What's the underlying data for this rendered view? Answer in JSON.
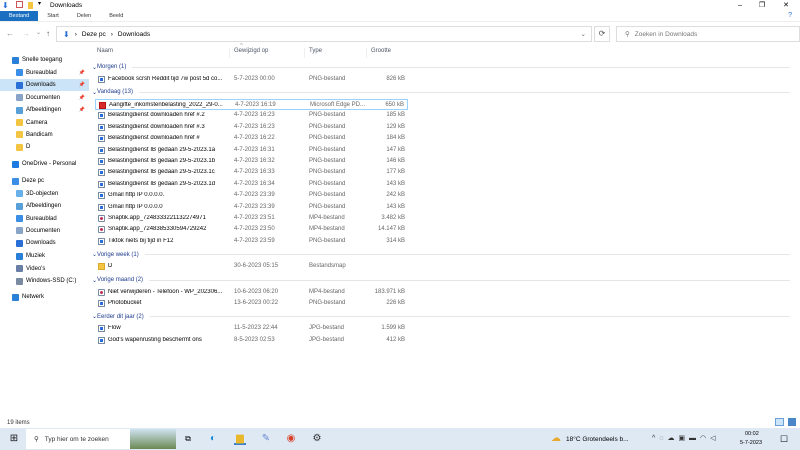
{
  "window": {
    "title": "Downloads"
  },
  "ribbon": {
    "tabs": [
      "Bestand",
      "Start",
      "Delen",
      "Beeld"
    ]
  },
  "address": {
    "crumbs": [
      "Deze pc",
      "Downloads"
    ],
    "search_placeholder": "Zoeken in Downloads"
  },
  "columns": {
    "name": "Naam",
    "date": "Gewijzigd op",
    "type": "Type",
    "size": "Grootte"
  },
  "sidebar": [
    {
      "label": "Snelle toegang",
      "icon": "star-icon",
      "color": "#2a7fd6",
      "indent": 0
    },
    {
      "label": "Bureaublad",
      "icon": "desktop-icon",
      "color": "#3a8ee6",
      "indent": 1,
      "pin": true
    },
    {
      "label": "Downloads",
      "icon": "download-icon",
      "color": "#2a6fd6",
      "indent": 1,
      "pin": true,
      "selected": true
    },
    {
      "label": "Documenten",
      "icon": "documents-icon",
      "color": "#8aa4c8",
      "indent": 1,
      "pin": true
    },
    {
      "label": "Afbeeldingen",
      "icon": "pictures-icon",
      "color": "#5aa0d8",
      "indent": 1,
      "pin": true
    },
    {
      "label": "Camera",
      "icon": "folder-icon",
      "color": "#f4c542",
      "indent": 1
    },
    {
      "label": "Bandicam",
      "icon": "folder-icon",
      "color": "#f4c542",
      "indent": 1
    },
    {
      "label": "D",
      "icon": "folder-icon",
      "color": "#f4c542",
      "indent": 1
    },
    {
      "label": "OneDrive - Personal",
      "icon": "cloud-icon",
      "color": "#1d7ae0",
      "indent": 0
    },
    {
      "label": "Deze pc",
      "icon": "computer-icon",
      "color": "#3a8ee6",
      "indent": 0
    },
    {
      "label": "3D-objecten",
      "icon": "cube-icon",
      "color": "#6ab0e8",
      "indent": 1
    },
    {
      "label": "Afbeeldingen",
      "icon": "pictures-icon",
      "color": "#5aa0d8",
      "indent": 1
    },
    {
      "label": "Bureaublad",
      "icon": "desktop-icon",
      "color": "#3a8ee6",
      "indent": 1
    },
    {
      "label": "Documenten",
      "icon": "documents-icon",
      "color": "#8aa4c8",
      "indent": 1
    },
    {
      "label": "Downloads",
      "icon": "download-icon",
      "color": "#2a6fd6",
      "indent": 1
    },
    {
      "label": "Muziek",
      "icon": "music-icon",
      "color": "#2a7fd6",
      "indent": 1
    },
    {
      "label": "Video's",
      "icon": "video-icon",
      "color": "#6a7fa6",
      "indent": 1
    },
    {
      "label": "Windows-SSD (C:)",
      "icon": "drive-icon",
      "color": "#7a8aa0",
      "indent": 1
    },
    {
      "label": "Netwerk",
      "icon": "network-icon",
      "color": "#2a7fd6",
      "indent": 0
    }
  ],
  "groups": [
    {
      "label": "Morgen (1)",
      "files": [
        {
          "name": "Facebook scrsh Reddit tijd 7w post 5d co...",
          "date": "5-7-2023 00:00",
          "type": "PNG-bestand",
          "size": "826 kB",
          "kind": "png"
        }
      ]
    },
    {
      "label": "Vandaag (13)",
      "files": [
        {
          "name": "Aangifte_inkomstenbelasting_2022_29-0...",
          "date": "4-7-2023 16:19",
          "type": "Microsoft Edge PD...",
          "size": "650 kB",
          "kind": "pdf",
          "selected": true
        },
        {
          "name": "Belastingdienst downloaden href #.2",
          "date": "4-7-2023 16:23",
          "type": "PNG-bestand",
          "size": "185 kB",
          "kind": "png"
        },
        {
          "name": "Belastingdienst downloaden href #.3",
          "date": "4-7-2023 16:23",
          "type": "PNG-bestand",
          "size": "129 kB",
          "kind": "png"
        },
        {
          "name": "Belastingdienst downloaden href #",
          "date": "4-7-2023 16:22",
          "type": "PNG-bestand",
          "size": "184 kB",
          "kind": "png"
        },
        {
          "name": "Belastingdienst IB gedaan 29-5-2023.1a",
          "date": "4-7-2023 16:31",
          "type": "PNG-bestand",
          "size": "147 kB",
          "kind": "png"
        },
        {
          "name": "Belastingdienst IB gedaan 29-5-2023.1b",
          "date": "4-7-2023 16:32",
          "type": "PNG-bestand",
          "size": "146 kB",
          "kind": "png"
        },
        {
          "name": "Belastingdienst IB gedaan 29-5-2023.1c",
          "date": "4-7-2023 16:33",
          "type": "PNG-bestand",
          "size": "177 kB",
          "kind": "png"
        },
        {
          "name": "Belastingdienst IB gedaan 29-5-2023.1d",
          "date": "4-7-2023 16:34",
          "type": "PNG-bestand",
          "size": "143 kB",
          "kind": "png"
        },
        {
          "name": "Gmail http IP 0.0.0.0.",
          "date": "4-7-2023 23:39",
          "type": "PNG-bestand",
          "size": "242 kB",
          "kind": "png"
        },
        {
          "name": "Gmail http IP 0.0.0.0",
          "date": "4-7-2023 23:39",
          "type": "PNG-bestand",
          "size": "143 kB",
          "kind": "png"
        },
        {
          "name": "Snaptik.app_7248333221132274971",
          "date": "4-7-2023 23:51",
          "type": "MP4-bestand",
          "size": "3.482 kB",
          "kind": "mp4"
        },
        {
          "name": "Snaptik.app_7248385330594729242",
          "date": "4-7-2023 23:50",
          "type": "MP4-bestand",
          "size": "14.147 kB",
          "kind": "mp4"
        },
        {
          "name": "Tiktok niets bij tijd in F12",
          "date": "4-7-2023 23:59",
          "type": "PNG-bestand",
          "size": "314 kB",
          "kind": "png"
        }
      ]
    },
    {
      "label": "Vorige week (1)",
      "files": [
        {
          "name": "D",
          "date": "30-6-2023 05:15",
          "type": "Bestandsmap",
          "size": "",
          "kind": "folder"
        }
      ]
    },
    {
      "label": "Vorige maand (2)",
      "files": [
        {
          "name": "Niet verwijderen - Telefoon - WP_202306...",
          "date": "10-6-2023 06:20",
          "type": "MP4-bestand",
          "size": "183.971 kB",
          "kind": "mp4"
        },
        {
          "name": "Photobucket",
          "date": "13-6-2023 00:22",
          "type": "PNG-bestand",
          "size": "226 kB",
          "kind": "png"
        }
      ]
    },
    {
      "label": "Eerder dit jaar (2)",
      "files": [
        {
          "name": "Flow",
          "date": "11-5-2023 22:44",
          "type": "JPG-bestand",
          "size": "1.599 kB",
          "kind": "png"
        },
        {
          "name": "God's wapenrusting beschermt ons",
          "date": "8-5-2023 02:53",
          "type": "JPG-bestand",
          "size": "412 kB",
          "kind": "png"
        }
      ]
    }
  ],
  "status": {
    "items": "19 items"
  },
  "taskbar": {
    "search_placeholder": "Typ hier om te zoeken",
    "weather": "18°C  Grotendeels b...",
    "time": "00:02",
    "date": "5-7-2023"
  }
}
